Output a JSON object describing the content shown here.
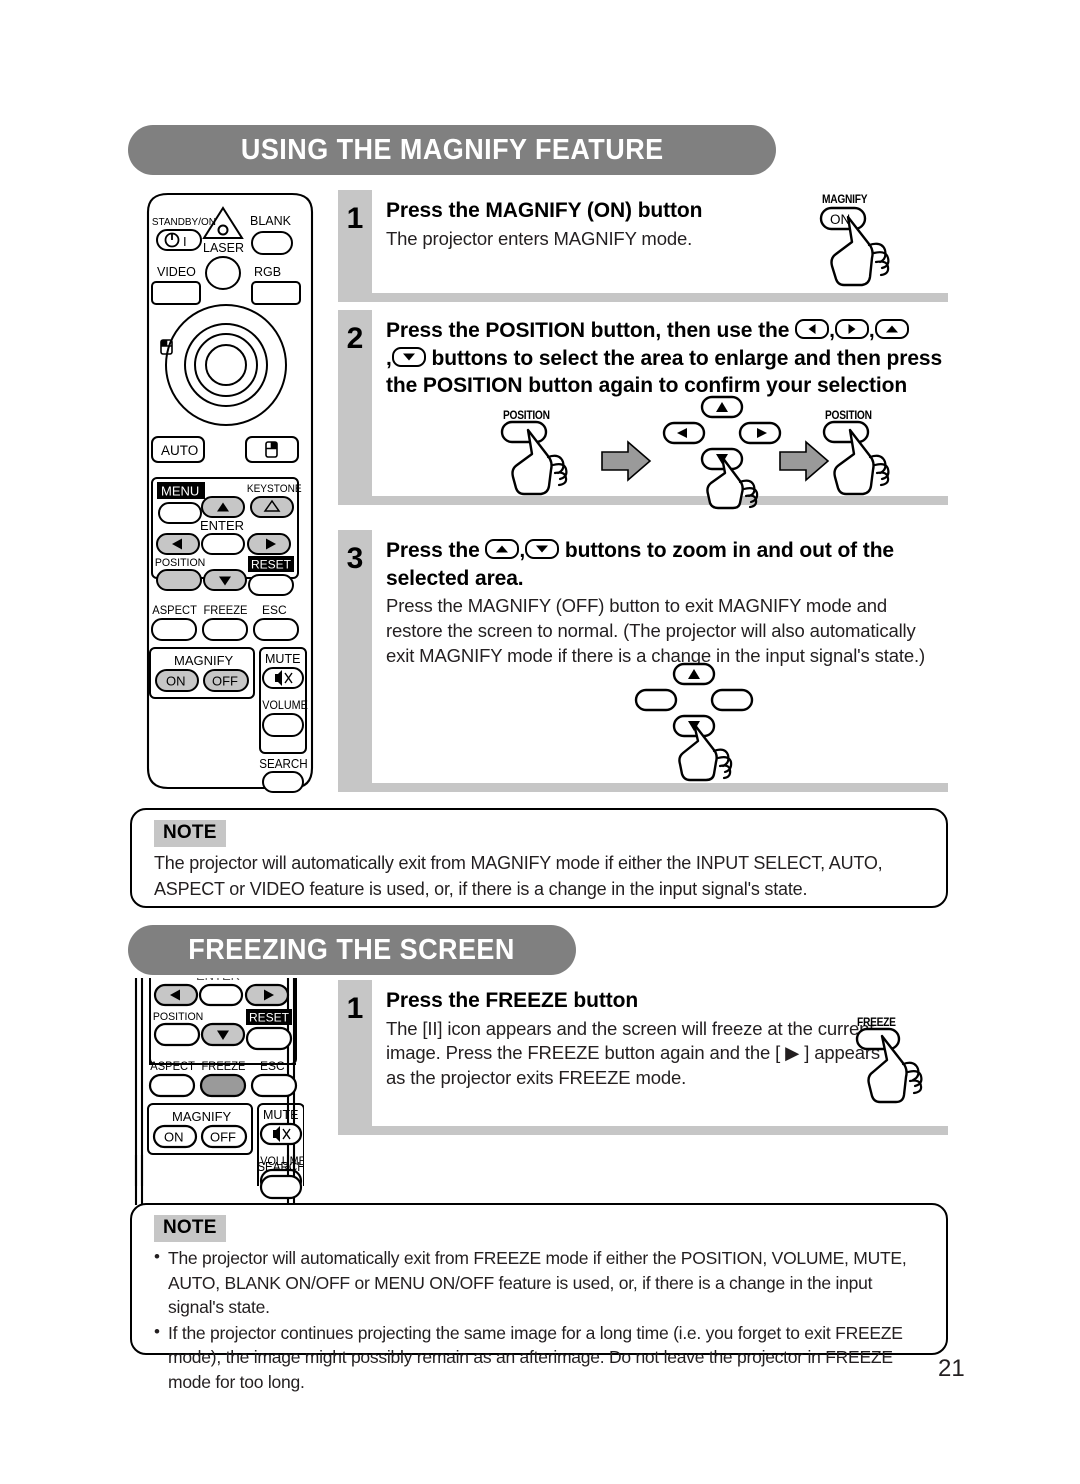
{
  "page": {
    "number": "21",
    "background": "#ffffff",
    "accent_gray": "#808080",
    "step_bar_gray": "#c6c6c6"
  },
  "sections": [
    {
      "id": "magnify",
      "banner": "USING THE MAGNIFY FEATURE",
      "steps": [
        {
          "number": "1",
          "title": "Press the MAGNIFY (ON) button",
          "desc": "The projector enters MAGNIFY mode."
        },
        {
          "number": "2",
          "title_part1": "Press the POSITION button, then use the ",
          "title_part2": " buttons to select the area to enlarge and then press the POSITION button again to confirm your selection",
          "desc": ""
        },
        {
          "number": "3",
          "title_part1": "Press the ",
          "title_part2": " buttons to zoom in and out of the selected area.",
          "desc": "Press the MAGNIFY (OFF) button to exit MAGNIFY mode and restore the screen to normal. (The projector will also automatically exit MAGNIFY mode if there is a change in the input signal's state.)"
        }
      ],
      "note": {
        "tag": "NOTE",
        "text": "The projector will automatically exit from MAGNIFY mode if either the INPUT SELECT, AUTO, ASPECT or VIDEO feature is used, or, if there is a change in the input signal's state."
      }
    },
    {
      "id": "freeze",
      "banner": "FREEZING THE SCREEN",
      "steps": [
        {
          "number": "1",
          "title": "Press the FREEZE button",
          "desc": "The [II] icon appears and the screen will freeze at the current image. Press the FREEZE button again and the [ ▶ ] appears as the projector exits FREEZE mode."
        }
      ],
      "note": {
        "tag": "NOTE",
        "items": [
          "The projector will automatically exit from FREEZE mode if either the POSITION, VOLUME, MUTE, AUTO, BLANK ON/OFF or MENU ON/OFF feature is used, or, if there is a change in the input signal's state.",
          "If the projector continues projecting the same image for a long time (i.e. you forget to exit FREEZE mode), the image might possibly remain as an afterimage. Do not leave the projector in FREEZE mode for too long."
        ]
      }
    }
  ],
  "remote_full": {
    "labels": {
      "standby": "STANDBY/ON",
      "laser": "LASER",
      "blank": "BLANK",
      "video": "VIDEO",
      "rgb": "RGB",
      "auto": "AUTO",
      "menu": "MENU",
      "keystone": "KEYSTONE",
      "enter": "ENTER",
      "position": "POSITION",
      "reset": "RESET",
      "aspect": "ASPECT",
      "freeze": "FREEZE",
      "esc": "ESC",
      "magnify": "MAGNIFY",
      "on": "ON",
      "off": "OFF",
      "mute": "MUTE",
      "volume": "VOLUME",
      "search": "SEARCH"
    }
  },
  "remote_partial": {
    "labels": {
      "enter": "ENTER",
      "position": "POSITION",
      "reset": "RESET",
      "aspect": "ASPECT",
      "freeze": "FREEZE",
      "esc": "ESC",
      "magnify": "MAGNIFY",
      "on": "ON",
      "off": "OFF",
      "mute": "MUTE",
      "volume": "VOLUME",
      "search": "SEARCH"
    }
  },
  "callouts": {
    "magnify_on": {
      "top_label": "MAGNIFY",
      "button_label": "ON"
    },
    "position_1": {
      "label": "POSITION"
    },
    "position_2": {
      "label": "POSITION"
    },
    "freeze": {
      "label": "FREEZE"
    }
  }
}
